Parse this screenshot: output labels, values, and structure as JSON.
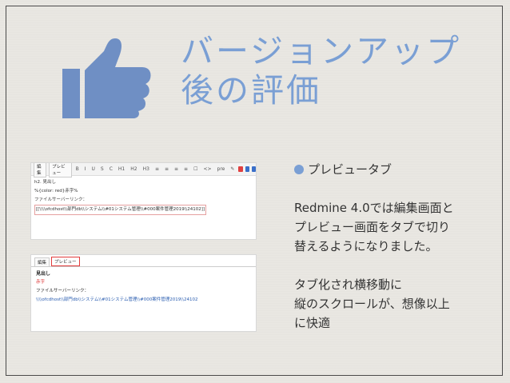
{
  "slide": {
    "title_lines": [
      "バージョンアップ",
      "後の評価"
    ],
    "bullet": "プレビュータブ",
    "paragraph1": [
      "Redmine 4.0では編集画面と",
      "プレビュー画面をタブで切り",
      "替えるようになりました。"
    ],
    "paragraph2": [
      "タブ化され横移動に",
      "縦のスクロールが、想像以上",
      "に快適"
    ],
    "colors": {
      "title": "#7a9fd4",
      "icon": "#6f8fc4",
      "bullet": "#7a9fd4",
      "text": "#333333",
      "background": "#e9e7e2"
    }
  },
  "thumb": {
    "icon": "thumbs-up-icon"
  },
  "editor": {
    "tabs": [
      "編集",
      "プレビュー"
    ],
    "toolbar_buttons": [
      "B",
      "I",
      "U",
      "S",
      "C",
      "H1",
      "H2",
      "H3",
      "≡",
      "≡",
      "≡",
      "≡",
      "☐",
      "<>",
      "pre",
      "✎"
    ],
    "lines": [
      "h2. 見出し",
      "%{color: red}赤字%",
      "ファイルサーバーリンク：",
      "[[\\\\\\\\ofcdhost\\\\部門db\\\\システム\\\\#01システム管理\\\\#000案件管理2019\\\\24102]]"
    ]
  },
  "preview": {
    "tabs": [
      "編集",
      "プレビュー"
    ],
    "heading": "見出し",
    "red_text": "赤字",
    "label": "ファイルサーバーリンク：",
    "link": "\\\\\\\\ofcdhost\\\\部門db\\\\システム\\\\#01システム管理\\\\#000案件管理2019\\\\24102"
  }
}
